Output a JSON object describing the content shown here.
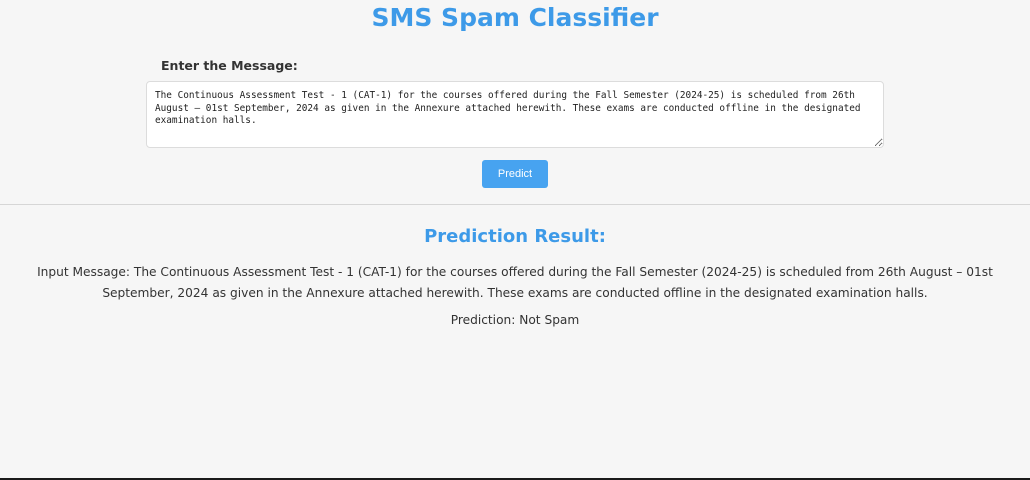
{
  "header": {
    "title": "SMS Spam Classifier"
  },
  "form": {
    "label": "Enter the Message:",
    "message_value": "The Continuous Assessment Test - 1 (CAT-1) for the courses offered during the Fall Semester (2024-25) is scheduled from 26th August – 01st September, 2024 as given in the Annexure attached herewith. These exams are conducted offline in the designated examination halls.",
    "predict_label": "Predict"
  },
  "result": {
    "title": "Prediction Result:",
    "input_message": "Input Message: The Continuous Assessment Test - 1 (CAT-1) for the courses offered during the Fall Semester (2024-25) is scheduled from 26th August – 01st September, 2024 as given in the Annexure attached herewith. These exams are conducted offline in the designated examination halls.",
    "prediction": "Prediction: Not Spam"
  },
  "colors": {
    "accent": "#3d9ae8",
    "button": "#47a3f0",
    "background": "#f6f6f6"
  }
}
